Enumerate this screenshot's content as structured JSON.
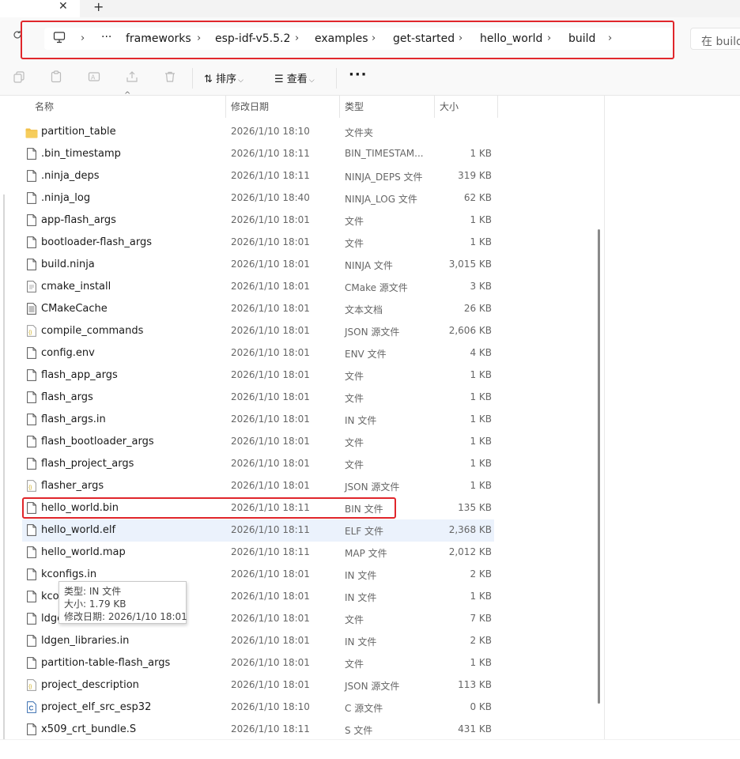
{
  "tabs": {
    "close_glyph": "✕",
    "new_glyph": "+"
  },
  "address_bar": {
    "overflow": "···",
    "crumbs": [
      "frameworks",
      "esp-idf-v5.5.2",
      "examples",
      "get-started",
      "hello_world",
      "build"
    ],
    "search_placeholder": "在 build"
  },
  "toolbar": {
    "sort_label": "排序",
    "view_label": "查看",
    "more": "···"
  },
  "columns": {
    "name": "名称",
    "date": "修改日期",
    "type": "类型",
    "size": "大小"
  },
  "files": [
    {
      "name": "partition_table",
      "date": "2026/1/10 18:10",
      "type": "文件夹",
      "size": "",
      "icon": "folder-icon"
    },
    {
      "name": ".bin_timestamp",
      "date": "2026/1/10 18:11",
      "type": "BIN_TIMESTAM...",
      "size": "1 KB",
      "icon": "file-icon"
    },
    {
      "name": ".ninja_deps",
      "date": "2026/1/10 18:11",
      "type": "NINJA_DEPS 文件",
      "size": "319 KB",
      "icon": "file-icon"
    },
    {
      "name": ".ninja_log",
      "date": "2026/1/10 18:40",
      "type": "NINJA_LOG 文件",
      "size": "62 KB",
      "icon": "file-icon"
    },
    {
      "name": "app-flash_args",
      "date": "2026/1/10 18:01",
      "type": "文件",
      "size": "1 KB",
      "icon": "file-icon"
    },
    {
      "name": "bootloader-flash_args",
      "date": "2026/1/10 18:01",
      "type": "文件",
      "size": "1 KB",
      "icon": "file-icon"
    },
    {
      "name": "build.ninja",
      "date": "2026/1/10 18:01",
      "type": "NINJA 文件",
      "size": "3,015 KB",
      "icon": "file-icon"
    },
    {
      "name": "cmake_install",
      "date": "2026/1/10 18:01",
      "type": "CMake 源文件",
      "size": "3 KB",
      "icon": "source-file-icon"
    },
    {
      "name": "CMakeCache",
      "date": "2026/1/10 18:01",
      "type": "文本文档",
      "size": "26 KB",
      "icon": "text-file-icon"
    },
    {
      "name": "compile_commands",
      "date": "2026/1/10 18:01",
      "type": "JSON 源文件",
      "size": "2,606 KB",
      "icon": "json-file-icon"
    },
    {
      "name": "config.env",
      "date": "2026/1/10 18:01",
      "type": "ENV 文件",
      "size": "4 KB",
      "icon": "file-icon"
    },
    {
      "name": "flash_app_args",
      "date": "2026/1/10 18:01",
      "type": "文件",
      "size": "1 KB",
      "icon": "file-icon"
    },
    {
      "name": "flash_args",
      "date": "2026/1/10 18:01",
      "type": "文件",
      "size": "1 KB",
      "icon": "file-icon"
    },
    {
      "name": "flash_args.in",
      "date": "2026/1/10 18:01",
      "type": "IN 文件",
      "size": "1 KB",
      "icon": "file-icon"
    },
    {
      "name": "flash_bootloader_args",
      "date": "2026/1/10 18:01",
      "type": "文件",
      "size": "1 KB",
      "icon": "file-icon"
    },
    {
      "name": "flash_project_args",
      "date": "2026/1/10 18:01",
      "type": "文件",
      "size": "1 KB",
      "icon": "file-icon"
    },
    {
      "name": "flasher_args",
      "date": "2026/1/10 18:01",
      "type": "JSON 源文件",
      "size": "1 KB",
      "icon": "json-file-icon"
    },
    {
      "name": "hello_world.bin",
      "date": "2026/1/10 18:11",
      "type": "BIN 文件",
      "size": "135 KB",
      "icon": "file-icon",
      "highlighted": true
    },
    {
      "name": "hello_world.elf",
      "date": "2026/1/10 18:11",
      "type": "ELF 文件",
      "size": "2,368 KB",
      "icon": "file-icon",
      "selected": true
    },
    {
      "name": "hello_world.map",
      "date": "2026/1/10 18:11",
      "type": "MAP 文件",
      "size": "2,012 KB",
      "icon": "file-icon"
    },
    {
      "name": "kconfigs.in",
      "date": "2026/1/10 18:01",
      "type": "IN 文件",
      "size": "2 KB",
      "icon": "file-icon"
    },
    {
      "name": "kconfigs_projbuild.in",
      "date": "2026/1/10 18:01",
      "type": "IN 文件",
      "size": "1 KB",
      "icon": "file-icon"
    },
    {
      "name": "ldgen_libraries",
      "date": "2026/1/10 18:01",
      "type": "文件",
      "size": "7 KB",
      "icon": "file-icon"
    },
    {
      "name": "ldgen_libraries.in",
      "date": "2026/1/10 18:01",
      "type": "IN 文件",
      "size": "2 KB",
      "icon": "file-icon"
    },
    {
      "name": "partition-table-flash_args",
      "date": "2026/1/10 18:01",
      "type": "文件",
      "size": "1 KB",
      "icon": "file-icon"
    },
    {
      "name": "project_description",
      "date": "2026/1/10 18:01",
      "type": "JSON 源文件",
      "size": "113 KB",
      "icon": "json-file-icon"
    },
    {
      "name": "project_elf_src_esp32",
      "date": "2026/1/10 18:10",
      "type": "C 源文件",
      "size": "0 KB",
      "icon": "c-file-icon"
    },
    {
      "name": "x509_crt_bundle.S",
      "date": "2026/1/10 18:11",
      "type": "S 文件",
      "size": "431 KB",
      "icon": "file-icon"
    }
  ],
  "tooltip": {
    "type_line": "类型: IN 文件",
    "size_line": "大小: 1.79 KB",
    "date_line": "修改日期: 2026/1/10 18:01"
  },
  "colors": {
    "highlight": "#e0262b",
    "selection": "#ebf2fc",
    "folder": "#f2c04a"
  }
}
